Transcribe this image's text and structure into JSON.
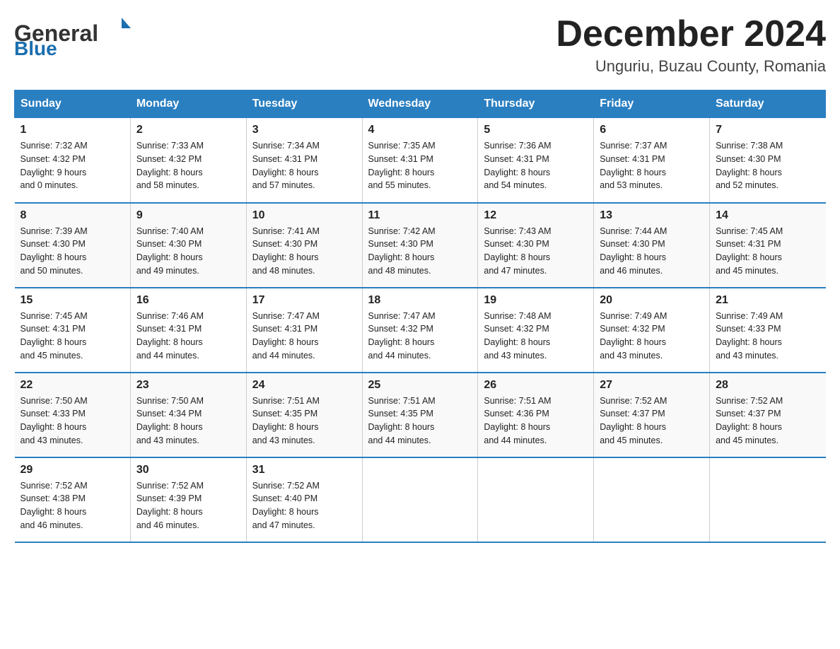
{
  "header": {
    "logo_general": "General",
    "logo_blue": "Blue",
    "month": "December 2024",
    "location": "Unguriu, Buzau County, Romania"
  },
  "days_of_week": [
    "Sunday",
    "Monday",
    "Tuesday",
    "Wednesday",
    "Thursday",
    "Friday",
    "Saturday"
  ],
  "weeks": [
    [
      {
        "day": "1",
        "sunrise": "7:32 AM",
        "sunset": "4:32 PM",
        "daylight": "9 hours and 0 minutes."
      },
      {
        "day": "2",
        "sunrise": "7:33 AM",
        "sunset": "4:32 PM",
        "daylight": "8 hours and 58 minutes."
      },
      {
        "day": "3",
        "sunrise": "7:34 AM",
        "sunset": "4:31 PM",
        "daylight": "8 hours and 57 minutes."
      },
      {
        "day": "4",
        "sunrise": "7:35 AM",
        "sunset": "4:31 PM",
        "daylight": "8 hours and 55 minutes."
      },
      {
        "day": "5",
        "sunrise": "7:36 AM",
        "sunset": "4:31 PM",
        "daylight": "8 hours and 54 minutes."
      },
      {
        "day": "6",
        "sunrise": "7:37 AM",
        "sunset": "4:31 PM",
        "daylight": "8 hours and 53 minutes."
      },
      {
        "day": "7",
        "sunrise": "7:38 AM",
        "sunset": "4:30 PM",
        "daylight": "8 hours and 52 minutes."
      }
    ],
    [
      {
        "day": "8",
        "sunrise": "7:39 AM",
        "sunset": "4:30 PM",
        "daylight": "8 hours and 50 minutes."
      },
      {
        "day": "9",
        "sunrise": "7:40 AM",
        "sunset": "4:30 PM",
        "daylight": "8 hours and 49 minutes."
      },
      {
        "day": "10",
        "sunrise": "7:41 AM",
        "sunset": "4:30 PM",
        "daylight": "8 hours and 48 minutes."
      },
      {
        "day": "11",
        "sunrise": "7:42 AM",
        "sunset": "4:30 PM",
        "daylight": "8 hours and 48 minutes."
      },
      {
        "day": "12",
        "sunrise": "7:43 AM",
        "sunset": "4:30 PM",
        "daylight": "8 hours and 47 minutes."
      },
      {
        "day": "13",
        "sunrise": "7:44 AM",
        "sunset": "4:30 PM",
        "daylight": "8 hours and 46 minutes."
      },
      {
        "day": "14",
        "sunrise": "7:45 AM",
        "sunset": "4:31 PM",
        "daylight": "8 hours and 45 minutes."
      }
    ],
    [
      {
        "day": "15",
        "sunrise": "7:45 AM",
        "sunset": "4:31 PM",
        "daylight": "8 hours and 45 minutes."
      },
      {
        "day": "16",
        "sunrise": "7:46 AM",
        "sunset": "4:31 PM",
        "daylight": "8 hours and 44 minutes."
      },
      {
        "day": "17",
        "sunrise": "7:47 AM",
        "sunset": "4:31 PM",
        "daylight": "8 hours and 44 minutes."
      },
      {
        "day": "18",
        "sunrise": "7:47 AM",
        "sunset": "4:32 PM",
        "daylight": "8 hours and 44 minutes."
      },
      {
        "day": "19",
        "sunrise": "7:48 AM",
        "sunset": "4:32 PM",
        "daylight": "8 hours and 43 minutes."
      },
      {
        "day": "20",
        "sunrise": "7:49 AM",
        "sunset": "4:32 PM",
        "daylight": "8 hours and 43 minutes."
      },
      {
        "day": "21",
        "sunrise": "7:49 AM",
        "sunset": "4:33 PM",
        "daylight": "8 hours and 43 minutes."
      }
    ],
    [
      {
        "day": "22",
        "sunrise": "7:50 AM",
        "sunset": "4:33 PM",
        "daylight": "8 hours and 43 minutes."
      },
      {
        "day": "23",
        "sunrise": "7:50 AM",
        "sunset": "4:34 PM",
        "daylight": "8 hours and 43 minutes."
      },
      {
        "day": "24",
        "sunrise": "7:51 AM",
        "sunset": "4:35 PM",
        "daylight": "8 hours and 43 minutes."
      },
      {
        "day": "25",
        "sunrise": "7:51 AM",
        "sunset": "4:35 PM",
        "daylight": "8 hours and 44 minutes."
      },
      {
        "day": "26",
        "sunrise": "7:51 AM",
        "sunset": "4:36 PM",
        "daylight": "8 hours and 44 minutes."
      },
      {
        "day": "27",
        "sunrise": "7:52 AM",
        "sunset": "4:37 PM",
        "daylight": "8 hours and 45 minutes."
      },
      {
        "day": "28",
        "sunrise": "7:52 AM",
        "sunset": "4:37 PM",
        "daylight": "8 hours and 45 minutes."
      }
    ],
    [
      {
        "day": "29",
        "sunrise": "7:52 AM",
        "sunset": "4:38 PM",
        "daylight": "8 hours and 46 minutes."
      },
      {
        "day": "30",
        "sunrise": "7:52 AM",
        "sunset": "4:39 PM",
        "daylight": "8 hours and 46 minutes."
      },
      {
        "day": "31",
        "sunrise": "7:52 AM",
        "sunset": "4:40 PM",
        "daylight": "8 hours and 47 minutes."
      },
      null,
      null,
      null,
      null
    ]
  ],
  "labels": {
    "sunrise": "Sunrise:",
    "sunset": "Sunset:",
    "daylight": "Daylight:"
  }
}
